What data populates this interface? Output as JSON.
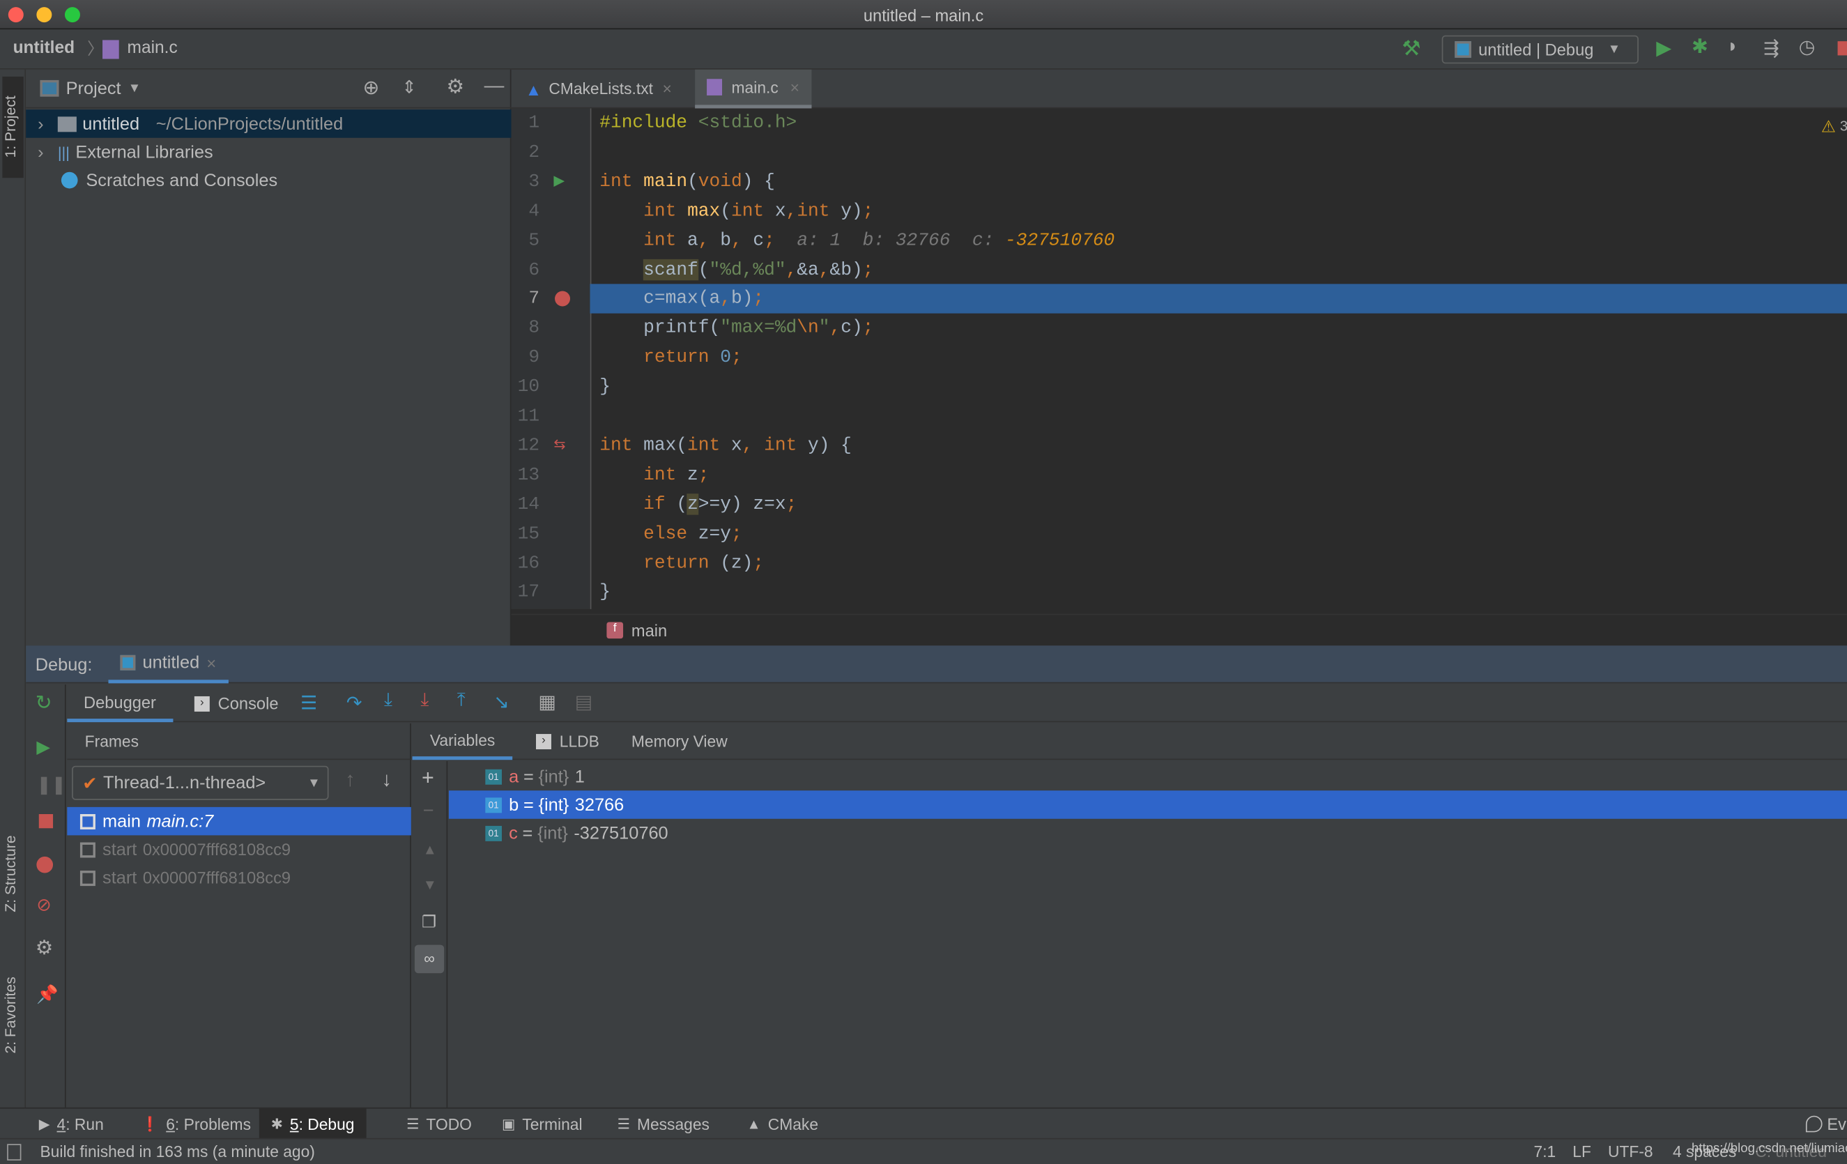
{
  "window": {
    "title": "untitled – main.c"
  },
  "navbar": {
    "project": "untitled",
    "file": "main.c",
    "run_config": "untitled | Debug"
  },
  "left_stripe": {
    "project_tab": "1: Project",
    "structure_tab": "Z: Structure",
    "favorites_tab": "2: Favorites"
  },
  "project_panel": {
    "title": "Project",
    "items": [
      {
        "label": "untitled",
        "path": "~/CLionProjects/untitled"
      },
      {
        "label": "External Libraries"
      },
      {
        "label": "Scratches and Consoles"
      }
    ]
  },
  "editor": {
    "tabs": [
      {
        "label": "CMakeLists.txt",
        "active": false
      },
      {
        "label": "main.c",
        "active": true
      }
    ],
    "warning_count": "3",
    "current_line": 7,
    "breakpoint_line": 7,
    "breadcrumb": "main",
    "lines": [
      [
        [
          "#include",
          "m"
        ],
        [
          " ",
          "p"
        ],
        [
          "<stdio.h>",
          "s"
        ]
      ],
      [],
      [
        [
          "int",
          "k"
        ],
        [
          " ",
          "p"
        ],
        [
          "main",
          "f"
        ],
        [
          "(",
          "p"
        ],
        [
          "void",
          "k"
        ],
        [
          ") {",
          "p"
        ]
      ],
      [
        [
          "    ",
          "p"
        ],
        [
          "int",
          "k"
        ],
        [
          " ",
          "p"
        ],
        [
          "max",
          "f"
        ],
        [
          "(",
          "p"
        ],
        [
          "int",
          "k"
        ],
        [
          " x",
          "p"
        ],
        [
          ",",
          "k"
        ],
        [
          "int",
          "k"
        ],
        [
          " y)",
          "p"
        ],
        [
          ";",
          "k"
        ]
      ],
      [
        [
          "    ",
          "p"
        ],
        [
          "int",
          "k"
        ],
        [
          " a",
          "p"
        ],
        [
          ",",
          "k"
        ],
        [
          " b",
          "p"
        ],
        [
          ",",
          "k"
        ],
        [
          " c",
          "p"
        ],
        [
          ";",
          "k"
        ],
        [
          "  a: 1  b: 32766  c: ",
          "h"
        ],
        [
          "-327510760",
          "hv"
        ]
      ],
      [
        [
          "    ",
          "p"
        ],
        [
          "scanf",
          "hl"
        ],
        [
          "(",
          "p"
        ],
        [
          "\"%d,%d\"",
          "s"
        ],
        [
          ",",
          "k"
        ],
        [
          "&a",
          "p"
        ],
        [
          ",",
          "k"
        ],
        [
          "&b)",
          "p"
        ],
        [
          ";",
          "k"
        ]
      ],
      [
        [
          "    ",
          "p"
        ],
        [
          "c=max(a",
          "p"
        ],
        [
          ",",
          "k"
        ],
        [
          "b)",
          "p"
        ],
        [
          ";",
          "k"
        ]
      ],
      [
        [
          "    ",
          "p"
        ],
        [
          "printf(",
          "p"
        ],
        [
          "\"max=%d",
          "s"
        ],
        [
          "\\n",
          "k"
        ],
        [
          "\"",
          "s"
        ],
        [
          ",",
          "k"
        ],
        [
          "c)",
          "p"
        ],
        [
          ";",
          "k"
        ]
      ],
      [
        [
          "    ",
          "p"
        ],
        [
          "return",
          "k"
        ],
        [
          " ",
          "p"
        ],
        [
          "0",
          "n"
        ],
        [
          ";",
          "k"
        ]
      ],
      [
        [
          "}",
          "p"
        ]
      ],
      [],
      [
        [
          "int",
          "k"
        ],
        [
          " max(",
          "p"
        ],
        [
          "int",
          "k"
        ],
        [
          " x",
          "p"
        ],
        [
          ",",
          "k"
        ],
        [
          " ",
          "p"
        ],
        [
          "int",
          "k"
        ],
        [
          " y) {",
          "p"
        ]
      ],
      [
        [
          "    ",
          "p"
        ],
        [
          "int",
          "k"
        ],
        [
          " z",
          "p"
        ],
        [
          ";",
          "k"
        ]
      ],
      [
        [
          "    ",
          "p"
        ],
        [
          "if",
          "k"
        ],
        [
          " (",
          "p"
        ],
        [
          "z",
          "hl"
        ],
        [
          ">=y) z=x",
          "p"
        ],
        [
          ";",
          "k"
        ]
      ],
      [
        [
          "    ",
          "p"
        ],
        [
          "else",
          "k"
        ],
        [
          " z=y",
          "p"
        ],
        [
          ";",
          "k"
        ]
      ],
      [
        [
          "    ",
          "p"
        ],
        [
          "return",
          "k"
        ],
        [
          " (z)",
          "p"
        ],
        [
          ";",
          "k"
        ]
      ],
      [
        [
          "}",
          "p"
        ]
      ]
    ]
  },
  "debug": {
    "label": "Debug:",
    "session": "untitled",
    "tabs": [
      "Debugger",
      "Console"
    ],
    "frames": {
      "title": "Frames",
      "thread": "Thread-1...n-thread>",
      "items": [
        {
          "name": "main",
          "location": "main.c:7"
        },
        {
          "name": "start",
          "location": "0x00007fff68108cc9"
        },
        {
          "name": "start",
          "location": "0x00007fff68108cc9"
        }
      ]
    },
    "var_tabs": [
      "Variables",
      "LLDB",
      "Memory View"
    ],
    "variables": [
      {
        "name": "a",
        "type": "{int}",
        "value": "1"
      },
      {
        "name": "b",
        "type": "{int}",
        "value": "32766",
        "selected": true
      },
      {
        "name": "c",
        "type": "{int}",
        "value": "-327510760"
      }
    ]
  },
  "toolwindows": [
    {
      "num": "4",
      "label": ": Run"
    },
    {
      "num": "6",
      "label": ": Problems"
    },
    {
      "num": "5",
      "label": ": Debug",
      "active": true
    },
    {
      "num": "",
      "label": "TODO"
    },
    {
      "num": "",
      "label": "Terminal"
    },
    {
      "num": "",
      "label": "Messages"
    },
    {
      "num": "",
      "label": "CMake"
    }
  ],
  "event_log": "Ev",
  "status": {
    "message": "Build finished in 163 ms (a minute ago)",
    "position": "7:1",
    "line_sep": "LF",
    "encoding": "UTF-8",
    "indent": "4 spaces",
    "context": "C: untitled",
    "watermark": "https://blog.csdn.net/liumiaocn"
  },
  "colors": {
    "accent": "#2f65ca",
    "current_line": "#2d5f99",
    "breakpoint": "#c75450",
    "keyword": "#cc7832",
    "function": "#ffc66d",
    "string": "#6a8759"
  }
}
